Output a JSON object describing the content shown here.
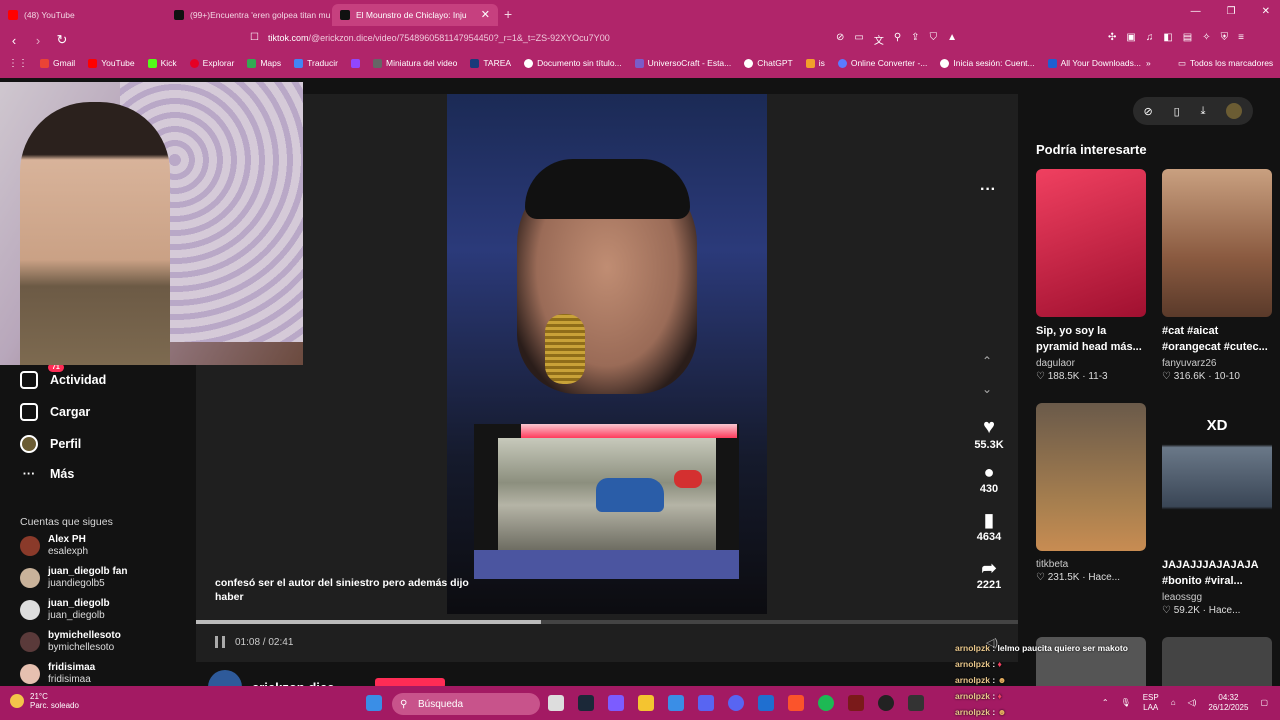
{
  "browser": {
    "tabs": [
      {
        "label": "(48) YouTube",
        "color": "#ff0000"
      },
      {
        "label": "(99+)Encuentra 'eren golpea titan mu",
        "color": "#111111"
      },
      {
        "label": "El Mounstro de Chiclayo: Inju",
        "color": "#111111"
      }
    ],
    "url_main": "tiktok.com",
    "url_rest": "/@erickzon.dice/video/7548960581147954450?_r=1&_t=ZS-92XYOcu7Y00",
    "bookmarks": [
      "Gmail",
      "YouTube",
      "Kick",
      "Explorar",
      "Maps",
      "Traducir",
      "",
      "Miniatura del video",
      "TAREA",
      "Documento sin título...",
      "UniversoCraft - Esta...",
      "ChatGPT",
      "is",
      "Online Converter -...",
      "Inicia sesión: Cuent...",
      "All Your Downloads..."
    ],
    "bookmarks_folder": "Todos los marcadores"
  },
  "sidebar": {
    "items": [
      {
        "label": "Actividad",
        "badge": "71"
      },
      {
        "label": "Cargar"
      },
      {
        "label": "Perfil"
      },
      {
        "label": "Más"
      }
    ],
    "following_header": "Cuentas que sigues",
    "accounts": [
      {
        "name": "Alex PH",
        "handle": "esalexph"
      },
      {
        "name": "juan_diegolb fan",
        "handle": "juandiegolb5"
      },
      {
        "name": "juan_diegolb",
        "handle": "juan_diegolb"
      },
      {
        "name": "bymichellesoto",
        "handle": "bymichellesoto"
      },
      {
        "name": "fridisimaa",
        "handle": "fridisimaa"
      }
    ]
  },
  "video": {
    "caption": "confesó ser el autor del siniestro pero además dijo haber",
    "time": "01:08 / 02:41",
    "progress": 0.42,
    "author": "erickzon.dice",
    "likes": "55.3K",
    "comments": "430",
    "saves": "4634",
    "shares": "2221"
  },
  "recommendations": {
    "header": "Podría interesarte",
    "cards": [
      {
        "title": "Sip, yo soy la\npyramid head más...",
        "user": "dagulaor",
        "stats": "♡ 188.5K · 11-3",
        "color": "#d02040"
      },
      {
        "title": "#cat #aicat\n#orangecat #cutec...",
        "user": "fanyuvarz26",
        "stats": "♡ 316.6K · 10-10",
        "color": "#8a6a55"
      },
      {
        "title": "",
        "user": "titkbeta",
        "stats": "♡ 231.5K · Hace...",
        "color": "#7a5e45"
      },
      {
        "title": "JAJAJJJAJAJAJA\n#bonito #viral...",
        "user": "leaossgg",
        "stats": "♡ 59.2K · Hace...",
        "color": "#3e4b5c",
        "overlay": "XD"
      }
    ]
  },
  "chat": [
    {
      "user": "arnolpzk",
      "msg": ": lelmo paucita quiero ser makoto"
    },
    {
      "user": "arnolpzk",
      "msg": ":"
    },
    {
      "user": "arnolpzk",
      "msg": ":"
    },
    {
      "user": "arnolpzk",
      "msg": ":"
    },
    {
      "user": "arnolpzk",
      "msg": ":"
    }
  ],
  "taskbar": {
    "temp": "21°C",
    "weather": "Parc. soleado",
    "search": "Búsqueda",
    "lang1": "ESP",
    "lang2": "LAA",
    "time": "04:32",
    "date": "26/12/2025"
  }
}
